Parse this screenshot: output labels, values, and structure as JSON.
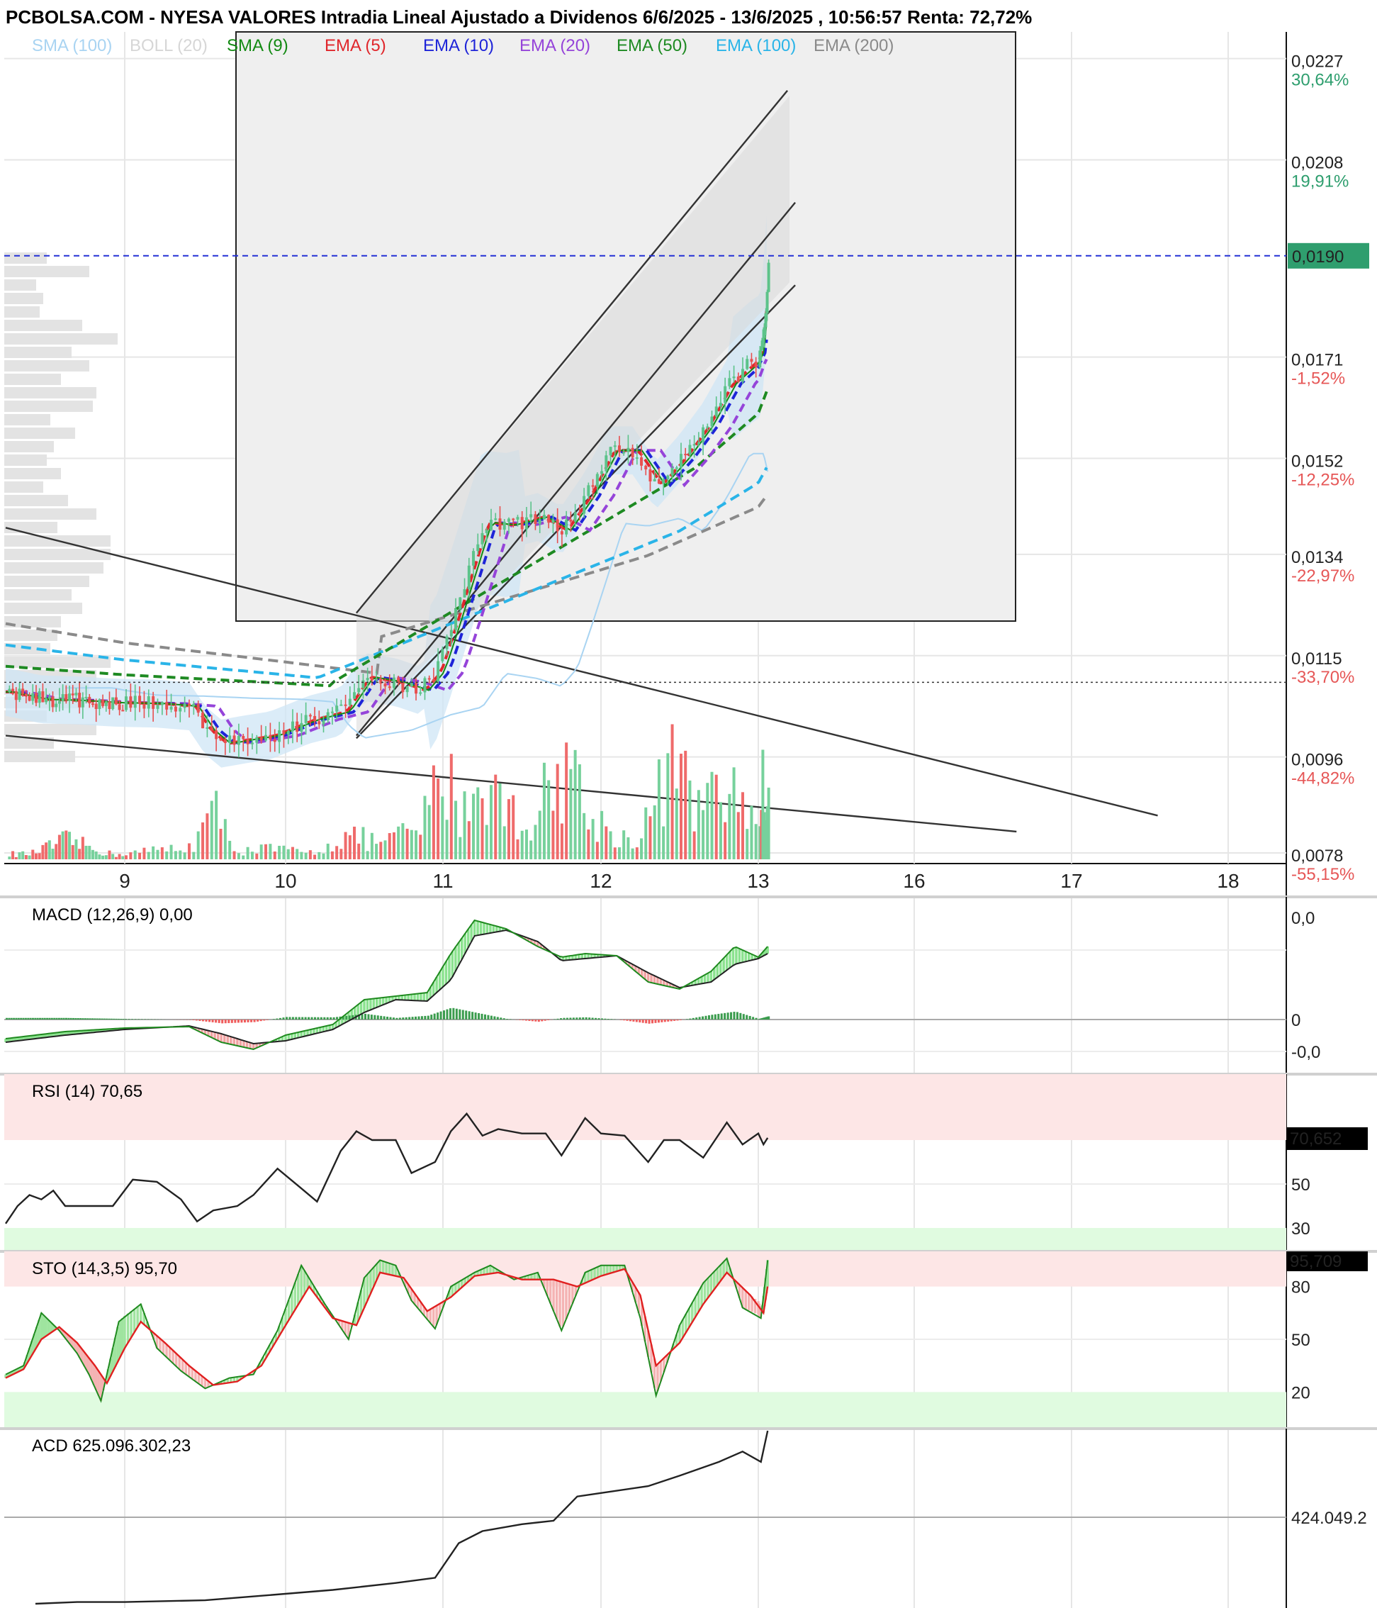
{
  "title": "PCBOLSA.COM - NYESA VALORES Intradia Lineal Ajustado a Dividenos 6/6/2025 - 13/6/2025 , 10:56:57 Renta: 72,72%",
  "legend": [
    {
      "label": "SMA (100)",
      "color": "#a9d4f2"
    },
    {
      "label": "BOLL (20)",
      "color": "#d6d6d6"
    },
    {
      "label": "SMA (9)",
      "color": "#138a13"
    },
    {
      "label": "EMA (5)",
      "color": "#e0262b"
    },
    {
      "label": "EMA (10)",
      "color": "#1e24d8"
    },
    {
      "label": "EMA (20)",
      "color": "#9544d9"
    },
    {
      "label": "EMA (50)",
      "color": "#1e8a22"
    },
    {
      "label": "EMA (100)",
      "color": "#2ab4e8"
    },
    {
      "label": "EMA (200)",
      "color": "#8a8a8a"
    }
  ],
  "current_price_label": "0,0190",
  "colors": {
    "up": "#77d19c",
    "down": "#ef6b6b",
    "price_badge": "#2f9e6e",
    "hline": "#2330d6"
  },
  "chart_data": [
    {
      "type": "candlestick",
      "name": "main",
      "x_ticks": [
        "9",
        "10",
        "11",
        "12",
        "13",
        "16",
        "17",
        "18"
      ],
      "y_ticks": [
        {
          "value": 0.0227,
          "label": "0,0227",
          "pct": "30,64%"
        },
        {
          "value": 0.0208,
          "label": "0,0208",
          "pct": "19,91%"
        },
        {
          "value": 0.019,
          "label": "0,0190",
          "pct": ""
        },
        {
          "value": 0.0171,
          "label": "0,0171",
          "pct": "-1,52%"
        },
        {
          "value": 0.0152,
          "label": "0,0152",
          "pct": "-12,25%"
        },
        {
          "value": 0.0134,
          "label": "0,0134",
          "pct": "-22,97%"
        },
        {
          "value": 0.0115,
          "label": "0,0115",
          "pct": "-33,70%"
        },
        {
          "value": 0.0096,
          "label": "0,0096",
          "pct": "-44,82%"
        },
        {
          "value": 0.0078,
          "label": "0,0078",
          "pct": "-55,15%"
        }
      ],
      "ylim": [
        0.0076,
        0.0232
      ],
      "last_price": 0.019,
      "reference_price": 0.011,
      "close_path": [
        [
          8.0,
          0.01082
        ],
        [
          8.3,
          0.01068
        ],
        [
          8.6,
          0.01066
        ],
        [
          8.9,
          0.01062
        ],
        [
          9.2,
          0.0106
        ],
        [
          9.4,
          0.01055
        ],
        [
          9.5,
          0.0101
        ],
        [
          9.6,
          0.00985
        ],
        [
          9.75,
          0.00993
        ],
        [
          9.9,
          0.01
        ],
        [
          10.0,
          0.01012
        ],
        [
          10.15,
          0.0103
        ],
        [
          10.35,
          0.01045
        ],
        [
          10.5,
          0.0111
        ],
        [
          10.7,
          0.011
        ],
        [
          10.85,
          0.01085
        ],
        [
          10.95,
          0.0112
        ],
        [
          11.05,
          0.0121
        ],
        [
          11.15,
          0.01305
        ],
        [
          11.25,
          0.014
        ],
        [
          11.4,
          0.01395
        ],
        [
          11.6,
          0.0141
        ],
        [
          11.75,
          0.01385
        ],
        [
          11.9,
          0.0145
        ],
        [
          12.05,
          0.01535
        ],
        [
          12.2,
          0.01535
        ],
        [
          12.35,
          0.0147
        ],
        [
          12.5,
          0.0152
        ],
        [
          12.65,
          0.0158
        ],
        [
          12.8,
          0.0166
        ],
        [
          12.95,
          0.017
        ],
        [
          13.05,
          0.0172
        ],
        [
          13.12,
          0.018
        ],
        [
          13.18,
          0.0189
        ]
      ],
      "volume_path": [
        [
          8.2,
          0.05
        ],
        [
          8.5,
          0.18
        ],
        [
          8.9,
          0.04
        ],
        [
          9.4,
          0.12
        ],
        [
          9.55,
          0.45
        ],
        [
          9.7,
          0.08
        ],
        [
          9.9,
          0.1
        ],
        [
          10.15,
          0.06
        ],
        [
          10.4,
          0.22
        ],
        [
          10.6,
          0.15
        ],
        [
          10.85,
          0.3
        ],
        [
          11.0,
          0.85
        ],
        [
          11.1,
          0.45
        ],
        [
          11.25,
          0.75
        ],
        [
          11.5,
          0.3
        ],
        [
          11.8,
          0.95
        ],
        [
          11.9,
          0.4
        ],
        [
          12.2,
          0.15
        ],
        [
          12.45,
          0.88
        ],
        [
          12.6,
          0.5
        ],
        [
          12.85,
          0.6
        ],
        [
          13.0,
          0.35
        ],
        [
          13.1,
          0.88
        ],
        [
          13.18,
          0.4
        ]
      ]
    },
    {
      "type": "line",
      "name": "MACD (12,26,9)",
      "value_label": "0,00",
      "y_ticks": [
        "0,0",
        "0",
        "-0,0"
      ]
    },
    {
      "type": "line",
      "name": "RSI (14)",
      "value_label": "70,65",
      "last_badge": "70,652",
      "y_ticks": [
        "50",
        "30"
      ],
      "ylim": [
        20,
        100
      ],
      "path": [
        [
          8.0,
          32
        ],
        [
          8.1,
          40
        ],
        [
          8.2,
          45
        ],
        [
          8.3,
          43
        ],
        [
          8.4,
          47
        ],
        [
          8.5,
          40
        ],
        [
          8.7,
          40
        ],
        [
          8.9,
          40
        ],
        [
          9.05,
          52
        ],
        [
          9.2,
          51
        ],
        [
          9.35,
          43
        ],
        [
          9.45,
          33
        ],
        [
          9.55,
          38
        ],
        [
          9.7,
          40
        ],
        [
          9.8,
          45
        ],
        [
          9.95,
          57
        ],
        [
          10.1,
          48
        ],
        [
          10.2,
          42
        ],
        [
          10.35,
          65
        ],
        [
          10.45,
          74
        ],
        [
          10.55,
          70
        ],
        [
          10.7,
          70
        ],
        [
          10.8,
          55
        ],
        [
          10.95,
          60
        ],
        [
          11.05,
          74
        ],
        [
          11.15,
          82
        ],
        [
          11.25,
          72
        ],
        [
          11.35,
          75
        ],
        [
          11.5,
          73
        ],
        [
          11.65,
          73
        ],
        [
          11.75,
          63
        ],
        [
          11.9,
          80
        ],
        [
          12.0,
          73
        ],
        [
          12.15,
          72
        ],
        [
          12.3,
          60
        ],
        [
          12.4,
          70
        ],
        [
          12.5,
          70
        ],
        [
          12.65,
          62
        ],
        [
          12.8,
          78
        ],
        [
          12.9,
          68
        ],
        [
          13.0,
          73
        ],
        [
          13.1,
          68
        ],
        [
          13.18,
          71
        ]
      ]
    },
    {
      "type": "line",
      "name": "STO (14,3,5)",
      "value_label": "95,70",
      "last_badge": "95,709",
      "y_ticks": [
        "80",
        "50",
        "20"
      ],
      "ylim": [
        0,
        100
      ],
      "k_path": [
        [
          8.0,
          30
        ],
        [
          8.15,
          35
        ],
        [
          8.3,
          65
        ],
        [
          8.45,
          55
        ],
        [
          8.6,
          42
        ],
        [
          8.7,
          30
        ],
        [
          8.8,
          15
        ],
        [
          8.95,
          60
        ],
        [
          9.1,
          70
        ],
        [
          9.2,
          45
        ],
        [
          9.35,
          32
        ],
        [
          9.5,
          22
        ],
        [
          9.65,
          28
        ],
        [
          9.8,
          30
        ],
        [
          9.95,
          55
        ],
        [
          10.1,
          92
        ],
        [
          10.25,
          70
        ],
        [
          10.4,
          50
        ],
        [
          10.5,
          85
        ],
        [
          10.6,
          95
        ],
        [
          10.7,
          92
        ],
        [
          10.8,
          72
        ],
        [
          10.95,
          56
        ],
        [
          11.05,
          80
        ],
        [
          11.2,
          88
        ],
        [
          11.3,
          92
        ],
        [
          11.45,
          84
        ],
        [
          11.6,
          88
        ],
        [
          11.75,
          55
        ],
        [
          11.9,
          88
        ],
        [
          12.0,
          92
        ],
        [
          12.15,
          92
        ],
        [
          12.25,
          62
        ],
        [
          12.35,
          18
        ],
        [
          12.5,
          58
        ],
        [
          12.65,
          82
        ],
        [
          12.8,
          96
        ],
        [
          12.9,
          68
        ],
        [
          13.05,
          62
        ],
        [
          13.18,
          95
        ]
      ],
      "d_path": [
        [
          8.0,
          28
        ],
        [
          8.15,
          33
        ],
        [
          8.3,
          50
        ],
        [
          8.45,
          57
        ],
        [
          8.6,
          48
        ],
        [
          8.75,
          35
        ],
        [
          8.85,
          25
        ],
        [
          9.0,
          45
        ],
        [
          9.1,
          60
        ],
        [
          9.25,
          48
        ],
        [
          9.4,
          35
        ],
        [
          9.55,
          24
        ],
        [
          9.7,
          26
        ],
        [
          9.85,
          35
        ],
        [
          10.0,
          58
        ],
        [
          10.15,
          80
        ],
        [
          10.3,
          62
        ],
        [
          10.45,
          58
        ],
        [
          10.6,
          88
        ],
        [
          10.75,
          85
        ],
        [
          10.9,
          66
        ],
        [
          11.05,
          74
        ],
        [
          11.2,
          86
        ],
        [
          11.35,
          88
        ],
        [
          11.5,
          84
        ],
        [
          11.7,
          84
        ],
        [
          11.85,
          80
        ],
        [
          12.0,
          86
        ],
        [
          12.15,
          90
        ],
        [
          12.25,
          75
        ],
        [
          12.35,
          35
        ],
        [
          12.5,
          48
        ],
        [
          12.65,
          70
        ],
        [
          12.8,
          88
        ],
        [
          12.95,
          75
        ],
        [
          13.1,
          65
        ],
        [
          13.18,
          80
        ]
      ]
    },
    {
      "type": "line",
      "name": "ACD",
      "value_label": "625.096.302,23",
      "y_ticks": [
        "424.049.2"
      ],
      "path": [
        [
          8.25,
          0.0
        ],
        [
          8.6,
          0.01
        ],
        [
          9.0,
          0.01
        ],
        [
          9.5,
          0.02
        ],
        [
          9.9,
          0.05
        ],
        [
          10.3,
          0.08
        ],
        [
          10.7,
          0.12
        ],
        [
          10.95,
          0.15
        ],
        [
          11.1,
          0.35
        ],
        [
          11.25,
          0.42
        ],
        [
          11.5,
          0.46
        ],
        [
          11.7,
          0.48
        ],
        [
          11.85,
          0.62
        ],
        [
          12.0,
          0.64
        ],
        [
          12.3,
          0.68
        ],
        [
          12.5,
          0.74
        ],
        [
          12.75,
          0.82
        ],
        [
          12.9,
          0.88
        ],
        [
          13.05,
          0.82
        ],
        [
          13.18,
          1.0
        ]
      ]
    }
  ]
}
